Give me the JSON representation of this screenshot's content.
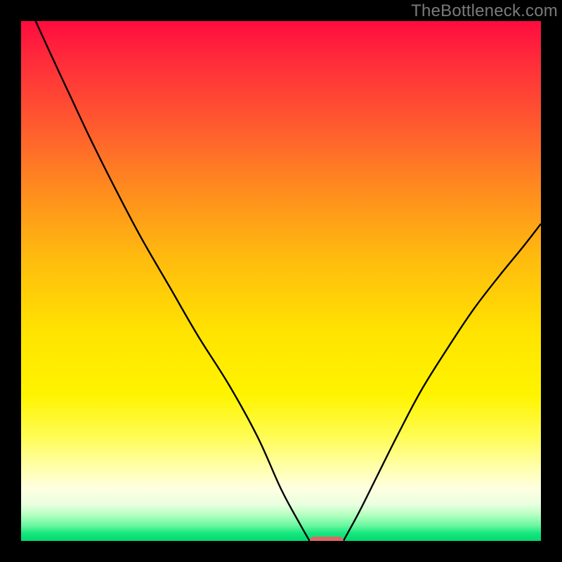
{
  "watermark": "TheBottleneck.com",
  "colors": {
    "frame": "#000000",
    "marker": "#e06666",
    "curve": "#000000"
  },
  "chart_data": {
    "type": "line",
    "title": "",
    "xlabel": "",
    "ylabel": "",
    "xlim": [
      0,
      1
    ],
    "ylim": [
      0,
      1
    ],
    "grid": false,
    "legend": false,
    "series": [
      {
        "name": "left-branch",
        "x": [
          0.028,
          0.06,
          0.095,
          0.135,
          0.18,
          0.23,
          0.285,
          0.34,
          0.4,
          0.455,
          0.5,
          0.535,
          0.555
        ],
        "y": [
          1.0,
          0.93,
          0.855,
          0.77,
          0.68,
          0.585,
          0.49,
          0.395,
          0.3,
          0.2,
          0.1,
          0.035,
          0.0
        ]
      },
      {
        "name": "right-branch",
        "x": [
          0.62,
          0.65,
          0.685,
          0.725,
          0.77,
          0.82,
          0.87,
          0.92,
          0.965,
          1.0
        ],
        "y": [
          0.0,
          0.055,
          0.125,
          0.205,
          0.29,
          0.37,
          0.445,
          0.51,
          0.565,
          0.61
        ]
      }
    ],
    "marker": {
      "x_start": 0.555,
      "x_end": 0.62,
      "y": 0.0
    }
  }
}
